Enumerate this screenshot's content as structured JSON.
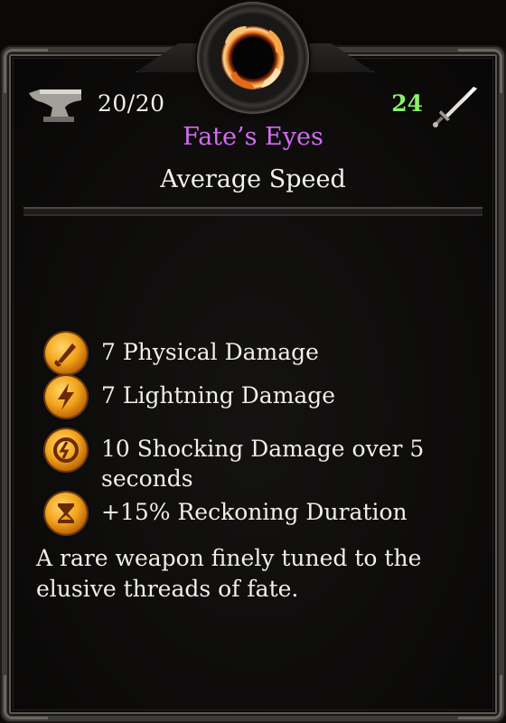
{
  "item": {
    "durability": "20/20",
    "damage": "24",
    "name": "Fate’s Eyes",
    "speed": "Average Speed",
    "name_color": "#d36bf2",
    "damage_color": "#8bf06a"
  },
  "properties": [
    {
      "icon": "physical-damage-icon",
      "text": "7 Physical Damage"
    },
    {
      "icon": "lightning-damage-icon",
      "text": "7 Lightning Damage"
    },
    {
      "icon": "shocking-damage-icon",
      "text": "10 Shocking Damage over 5 seconds"
    },
    {
      "icon": "reckoning-duration-icon",
      "text": "+15% Reckoning Duration"
    }
  ],
  "description": "A rare weapon finely tuned to the elusive threads of fate.",
  "icons": {
    "medallion": "ring-icon",
    "durability": "anvil-icon",
    "damage": "sword-icon"
  }
}
